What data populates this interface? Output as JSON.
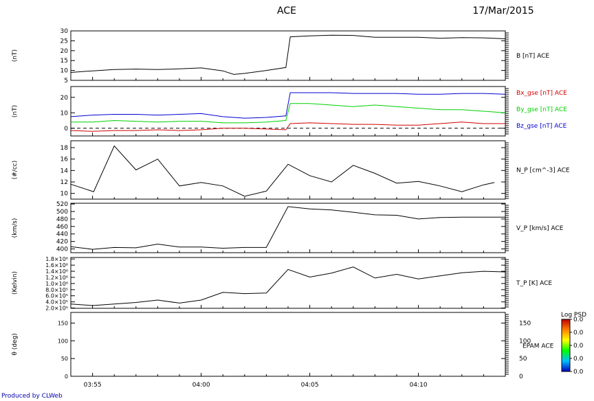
{
  "header": {
    "title": "ACE",
    "date": "17/Mar/2015"
  },
  "credit": "Produced by CLWeb",
  "time_ticks": [
    "03:55",
    "04:00",
    "04:05",
    "04:10"
  ],
  "colorbar": {
    "label": "Log PSD",
    "ticks": [
      "0.0",
      "0.0",
      "0.0",
      "0.0",
      "0.0"
    ],
    "colors": [
      "#0000c0",
      "#00c0ff",
      "#00ff00",
      "#ffff00",
      "#ff8000",
      "#c00000"
    ]
  },
  "chart_data": [
    {
      "type": "line",
      "id": "b-total",
      "ylabel": "(nT)",
      "ylim": [
        5,
        30
      ],
      "yticks": [
        5,
        10,
        15,
        20,
        25,
        30
      ],
      "series": [
        {
          "name": "B [nT] ACE",
          "color": "#000000",
          "x": [
            0,
            1,
            2,
            3,
            4,
            5,
            6,
            7,
            7.5,
            8,
            9,
            9.9,
            10.1,
            11,
            12,
            13,
            14,
            15,
            16,
            17,
            18,
            19,
            20
          ],
          "y": [
            9,
            9.8,
            10.5,
            10.7,
            10.5,
            10.8,
            11.3,
            9.8,
            8,
            8.5,
            10,
            11.5,
            27,
            27.5,
            27.8,
            27.7,
            26.8,
            26.8,
            26.8,
            26.3,
            26.6,
            26.5,
            26
          ]
        }
      ]
    },
    {
      "type": "line",
      "id": "b-components",
      "ylabel": "(nT)",
      "ylim": [
        -5,
        27
      ],
      "yticks": [
        0,
        10,
        20
      ],
      "series": [
        {
          "name": "Bx_gse [nT] ACE",
          "color": "#d00000",
          "x": [
            0,
            1,
            2,
            3,
            4,
            5,
            6,
            7,
            8,
            9,
            9.9,
            10.1,
            11,
            12,
            13,
            14,
            15,
            16,
            17,
            18,
            19,
            20
          ],
          "y": [
            -1.5,
            -2,
            -1.5,
            -1.5,
            -1,
            -1.5,
            -1,
            0,
            0,
            -0.5,
            -1,
            3,
            3.5,
            3,
            2.5,
            2.5,
            2,
            2,
            3,
            4,
            3,
            3
          ]
        },
        {
          "name": "By_gse [nT] ACE",
          "color": "#00d000",
          "x": [
            0,
            1,
            2,
            3,
            4,
            5,
            6,
            7,
            8,
            9,
            9.9,
            10.1,
            11,
            12,
            13,
            14,
            15,
            16,
            17,
            18,
            19,
            20
          ],
          "y": [
            4,
            4,
            5,
            4.5,
            4,
            4.5,
            4.5,
            3.5,
            3.5,
            4,
            5,
            16,
            16,
            15,
            14,
            15,
            14,
            13,
            12,
            12,
            11,
            10
          ]
        },
        {
          "name": "Bz_gse [nT] ACE",
          "color": "#0000d0",
          "x": [
            0,
            1,
            2,
            3,
            4,
            5,
            6,
            7,
            8,
            9,
            9.9,
            10.1,
            11,
            12,
            13,
            14,
            15,
            16,
            17,
            18,
            19,
            20
          ],
          "y": [
            7.5,
            8.5,
            9,
            9,
            8.5,
            9,
            9.5,
            7.5,
            6.5,
            7,
            8,
            23,
            23,
            23,
            22.5,
            22.5,
            22.5,
            22,
            22,
            22.5,
            22.5,
            22
          ]
        }
      ],
      "reference_line": 0
    },
    {
      "type": "line",
      "id": "np",
      "ylabel": "(#/cc)",
      "ylim": [
        9,
        19.2
      ],
      "yticks": [
        10,
        12,
        14,
        16,
        18
      ],
      "series": [
        {
          "name": "N_P [cm^-3] ACE",
          "color": "#000000",
          "x": [
            0,
            1.05,
            2,
            3,
            4,
            5,
            6,
            7,
            8,
            9,
            10,
            11,
            12,
            13,
            14,
            15,
            16,
            17,
            18,
            19,
            19.5
          ],
          "y": [
            11.6,
            10.3,
            18.3,
            14.1,
            16,
            11.3,
            11.9,
            11.3,
            9.5,
            10.4,
            15.1,
            13.1,
            12,
            14.9,
            13.5,
            11.8,
            12.1,
            11.3,
            10.3,
            11.5,
            11.9
          ]
        }
      ]
    },
    {
      "type": "line",
      "id": "vp",
      "ylabel": "(km/s)",
      "ylim": [
        390,
        522
      ],
      "yticks": [
        400,
        420,
        440,
        460,
        480,
        500,
        520
      ],
      "series": [
        {
          "name": "V_P [km/s] ACE",
          "color": "#000000",
          "x": [
            0,
            1,
            2,
            3,
            4,
            5,
            6,
            7,
            8,
            9,
            10,
            11,
            12,
            13,
            14,
            15,
            16,
            17,
            18,
            19,
            20
          ],
          "y": [
            406,
            399,
            404,
            403,
            413,
            405,
            405,
            402,
            404,
            404,
            513,
            507,
            504,
            498,
            491,
            490,
            480,
            484,
            485,
            485,
            485
          ]
        }
      ]
    },
    {
      "type": "line",
      "id": "tp",
      "ylabel": "(Kelvin)",
      "ylim": [
        190000,
        1850000
      ],
      "yticks": [
        200000,
        400000,
        600000,
        800000,
        1000000,
        1200000,
        1400000,
        1600000,
        1800000
      ],
      "ytick_labels": [
        "2.0×10⁵",
        "4.0×10⁵",
        "6.0×10⁵",
        "8.0×10⁵",
        "1.0×10⁶",
        "1.2×10⁶",
        "1.4×10⁶",
        "1.6×10⁶",
        "1.8×10⁶"
      ],
      "series": [
        {
          "name": "T_P [K] ACE",
          "color": "#000000",
          "x": [
            0,
            1,
            2,
            3,
            4,
            5,
            6,
            7,
            8,
            9,
            10,
            11,
            12,
            13,
            14,
            15,
            16,
            17,
            18,
            19,
            20
          ],
          "y": [
            330000,
            280000,
            330000,
            380000,
            460000,
            360000,
            460000,
            710000,
            670000,
            690000,
            1460000,
            1210000,
            1340000,
            1540000,
            1180000,
            1300000,
            1150000,
            1250000,
            1350000,
            1400000,
            1380000
          ]
        }
      ]
    },
    {
      "type": "heatmap",
      "id": "epam",
      "ylabel": "θ (deg)",
      "ylim": [
        0,
        180
      ],
      "yticks": [
        0,
        50,
        100,
        150
      ],
      "ytick_labels": [
        "0",
        "50",
        "100",
        "150"
      ],
      "series": [
        {
          "name": "EPAM ACE"
        }
      ]
    }
  ]
}
